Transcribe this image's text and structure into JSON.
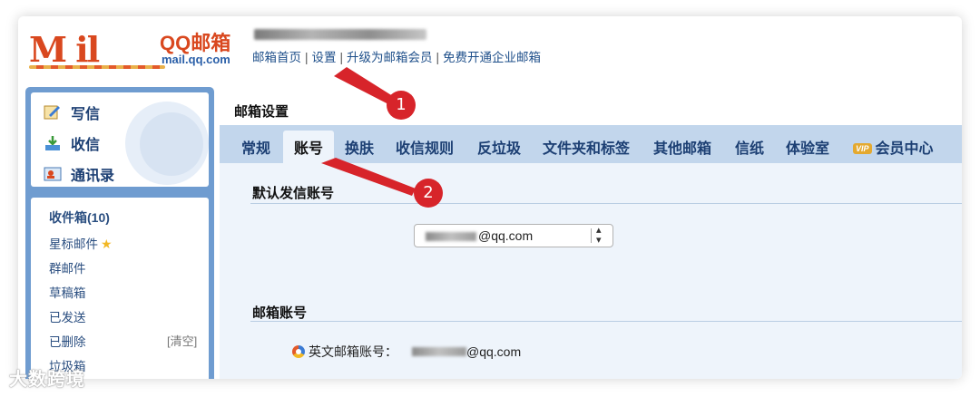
{
  "header": {
    "logo_text": "M   il",
    "brand": "QQ邮箱",
    "domain": "mail.qq.com",
    "nav": [
      {
        "label": "邮箱首页"
      },
      {
        "label": "设置"
      },
      {
        "label": "升级为邮箱会员"
      },
      {
        "label": "免费开通企业邮箱"
      }
    ],
    "nav_separator": "|"
  },
  "sidebar": {
    "quick": [
      {
        "label": "写信",
        "icon": "compose-icon"
      },
      {
        "label": "收信",
        "icon": "inbox-download-icon"
      },
      {
        "label": "通讯录",
        "icon": "contacts-icon"
      }
    ],
    "folders": [
      {
        "label": "收件箱(10)"
      },
      {
        "label": "星标邮件"
      },
      {
        "label": "群邮件"
      },
      {
        "label": "草稿箱"
      },
      {
        "label": "已发送"
      },
      {
        "label": "已删除"
      },
      {
        "label": "垃圾箱"
      }
    ],
    "clear_label": "[清空]",
    "star_glyph": "★"
  },
  "main": {
    "title": "邮箱设置",
    "tabs": [
      {
        "label": "常规"
      },
      {
        "label": "账号",
        "active": true
      },
      {
        "label": "换肤"
      },
      {
        "label": "收信规则"
      },
      {
        "label": "反垃圾"
      },
      {
        "label": "文件夹和标签"
      },
      {
        "label": "其他邮箱"
      },
      {
        "label": "信纸"
      },
      {
        "label": "体验室"
      },
      {
        "label": "会员中心",
        "badge": "VIP"
      }
    ],
    "default_sender_title": "默认发信账号",
    "default_sender_value": "@qq.com",
    "mail_account_title": "邮箱账号",
    "english_account_label": "英文邮箱账号：",
    "english_account_value": "@qq.com"
  },
  "annotations": [
    {
      "number": "1"
    },
    {
      "number": "2"
    }
  ],
  "watermark": "大数跨境",
  "colors": {
    "accent_blue": "#1e4f8a",
    "sidebar_blue": "#6f9cd0",
    "tabbar_blue": "#c2d6ec",
    "content_bg": "#eef4fb",
    "annotation_red": "#d7242a",
    "logo_red": "#d9481f"
  }
}
